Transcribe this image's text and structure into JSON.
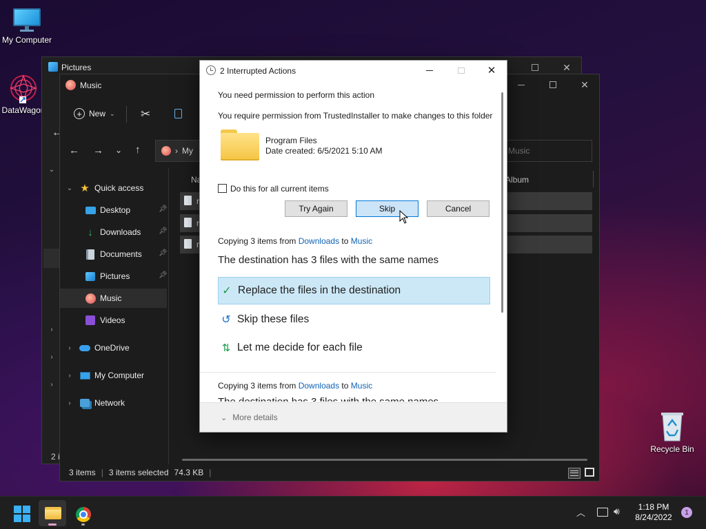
{
  "desktop": {
    "icons": [
      {
        "label": "My Computer"
      },
      {
        "label": "DataWagon"
      },
      {
        "label": "Recycle Bin"
      }
    ]
  },
  "pictures_window": {
    "title": "Pictures",
    "status": "2 i"
  },
  "explorer": {
    "title": "Music",
    "toolbar": {
      "new_label": "New"
    },
    "address": {
      "crumb": "My"
    },
    "search_placeholder": "Music",
    "columns": {
      "name": "Na",
      "album": "Album"
    },
    "file_rows": [
      "r",
      "r",
      "r"
    ],
    "nav": {
      "quick_access": "Quick access",
      "items": [
        {
          "label": "Desktop"
        },
        {
          "label": "Downloads"
        },
        {
          "label": "Documents"
        },
        {
          "label": "Pictures"
        },
        {
          "label": "Music"
        },
        {
          "label": "Videos"
        }
      ],
      "onedrive": "OneDrive",
      "my_computer": "My Computer",
      "network": "Network"
    },
    "statusbar": {
      "items": "3 items",
      "selected": "3 items selected",
      "size": "74.3 KB"
    }
  },
  "dialog": {
    "title": "2 Interrupted Actions",
    "permission_heading": "You need permission to perform this action",
    "permission_detail": "You require permission from TrustedInstaller to make changes to this folder",
    "folder_name": "Program Files",
    "folder_date": "Date created: 6/5/2021 5:10 AM",
    "checkbox_label": "Do this for all current items",
    "buttons": {
      "try_again": "Try Again",
      "skip": "Skip",
      "cancel": "Cancel"
    },
    "copy1": {
      "prefix": "Copying 3 items from ",
      "from": "Downloads",
      "mid": " to ",
      "to": "Music"
    },
    "conflict_heading": "The destination has 3 files with the same names",
    "options": {
      "replace": "Replace the files in the destination",
      "skip": "Skip these files",
      "decide": "Let me decide for each file"
    },
    "copy2": {
      "prefix": "Copying 3 items from ",
      "from": "Downloads",
      "mid": " to ",
      "to": "Music"
    },
    "cut_heading": "The destination has 3 files with the same names",
    "more_details": "More details"
  },
  "taskbar": {
    "time": "1:18 PM",
    "date": "8/24/2022",
    "notification_count": "1"
  },
  "colors": {
    "accent": "#0078d7",
    "selected_option": "#cce8f6",
    "link": "#0f63b6"
  }
}
